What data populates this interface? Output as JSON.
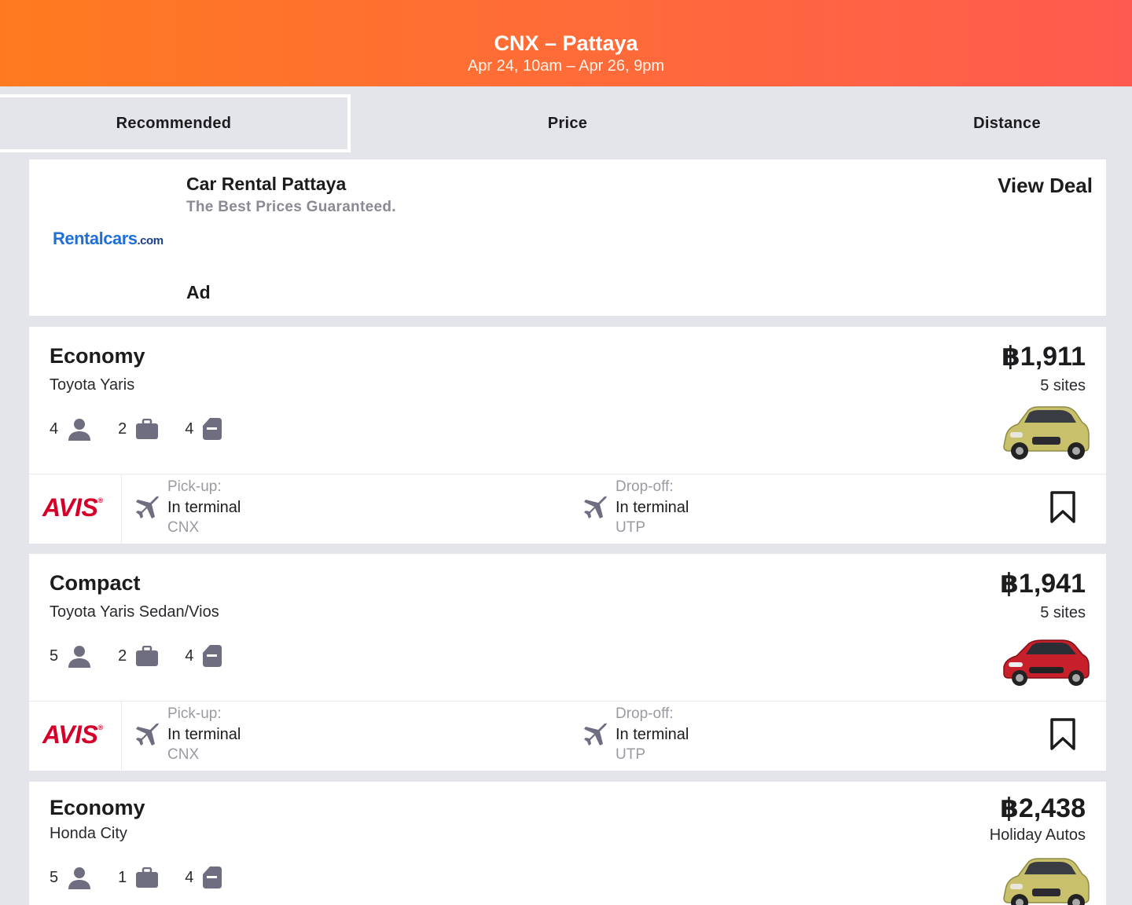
{
  "header": {
    "title": "CNX – Pattaya",
    "subtitle": "Apr 24, 10am – Apr 26, 9pm"
  },
  "tabs": [
    {
      "label": "Recommended",
      "active": true
    },
    {
      "label": "Price",
      "active": false
    },
    {
      "label": "Distance",
      "active": false
    }
  ],
  "ad": {
    "logo_main": "Rentalcars",
    "logo_suffix": ".com",
    "title": "Car Rental Pattaya",
    "subtitle": "The Best Prices Guaranteed.",
    "tag": "Ad",
    "cta": "View Deal"
  },
  "deals": [
    {
      "class": "Economy",
      "model": "Toyota Yaris",
      "passengers": "4",
      "bags": "2",
      "doors": "4",
      "price": "฿1,911",
      "sites": "5 sites",
      "car_color": "#c8c06a",
      "agency": "AVIS",
      "pickup_label": "Pick-up:",
      "pickup_value": "In terminal",
      "pickup_code": "CNX",
      "dropoff_label": "Drop-off:",
      "dropoff_value": "In terminal",
      "dropoff_code": "UTP"
    },
    {
      "class": "Compact",
      "model": "Toyota Yaris Sedan/Vios",
      "passengers": "5",
      "bags": "2",
      "doors": "4",
      "price": "฿1,941",
      "sites": "5 sites",
      "car_color": "#c8202a",
      "agency": "AVIS",
      "pickup_label": "Pick-up:",
      "pickup_value": "In terminal",
      "pickup_code": "CNX",
      "dropoff_label": "Drop-off:",
      "dropoff_value": "In terminal",
      "dropoff_code": "UTP"
    },
    {
      "class": "Economy",
      "model": "Honda City",
      "passengers": "5",
      "bags": "1",
      "doors": "4",
      "price": "฿2,438",
      "sites": "Holiday Autos",
      "car_color": "#c8c06a"
    }
  ],
  "icons": {
    "passengers": "person-icon",
    "bags": "briefcase-icon",
    "doors": "door-icon",
    "plane": "airplane-icon",
    "save": "bookmark-icon"
  },
  "colors": {
    "header_start": "#ff7a1f",
    "header_end": "#ff5a50",
    "avis_red": "#d4002a",
    "rentalcars_blue": "#1f6fd6",
    "icon_gray": "#6e6e80"
  }
}
